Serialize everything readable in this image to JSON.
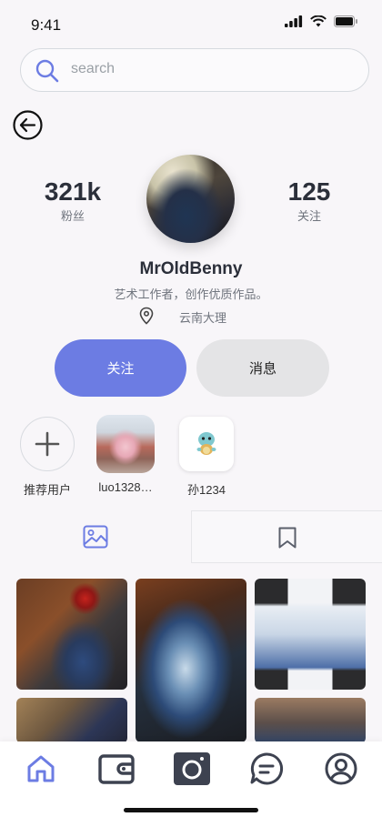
{
  "status_bar": {
    "time": "9:41"
  },
  "search": {
    "placeholder": "search"
  },
  "profile": {
    "followers_value": "321k",
    "followers_label": "粉丝",
    "following_value": "125",
    "following_label": "关注",
    "username": "MrOldBenny",
    "bio": "艺术工作者，创作优质作品。",
    "location": "云南大理"
  },
  "actions": {
    "follow_label": "关注",
    "message_label": "消息"
  },
  "recommended": {
    "add_label": "推荐用户",
    "users": [
      {
        "name": "luo1328…"
      },
      {
        "name": "孙1234"
      }
    ]
  },
  "colors": {
    "accent": "#6c7ce3",
    "secondary_button": "#e4e4e6",
    "nav_icon": "#3d4250"
  },
  "tabs": [
    {
      "icon": "image-icon"
    },
    {
      "icon": "bookmark-icon"
    }
  ],
  "bottom_nav": [
    {
      "icon": "home-icon"
    },
    {
      "icon": "wallet-icon"
    },
    {
      "icon": "camera-icon"
    },
    {
      "icon": "chat-icon"
    },
    {
      "icon": "profile-icon"
    }
  ]
}
